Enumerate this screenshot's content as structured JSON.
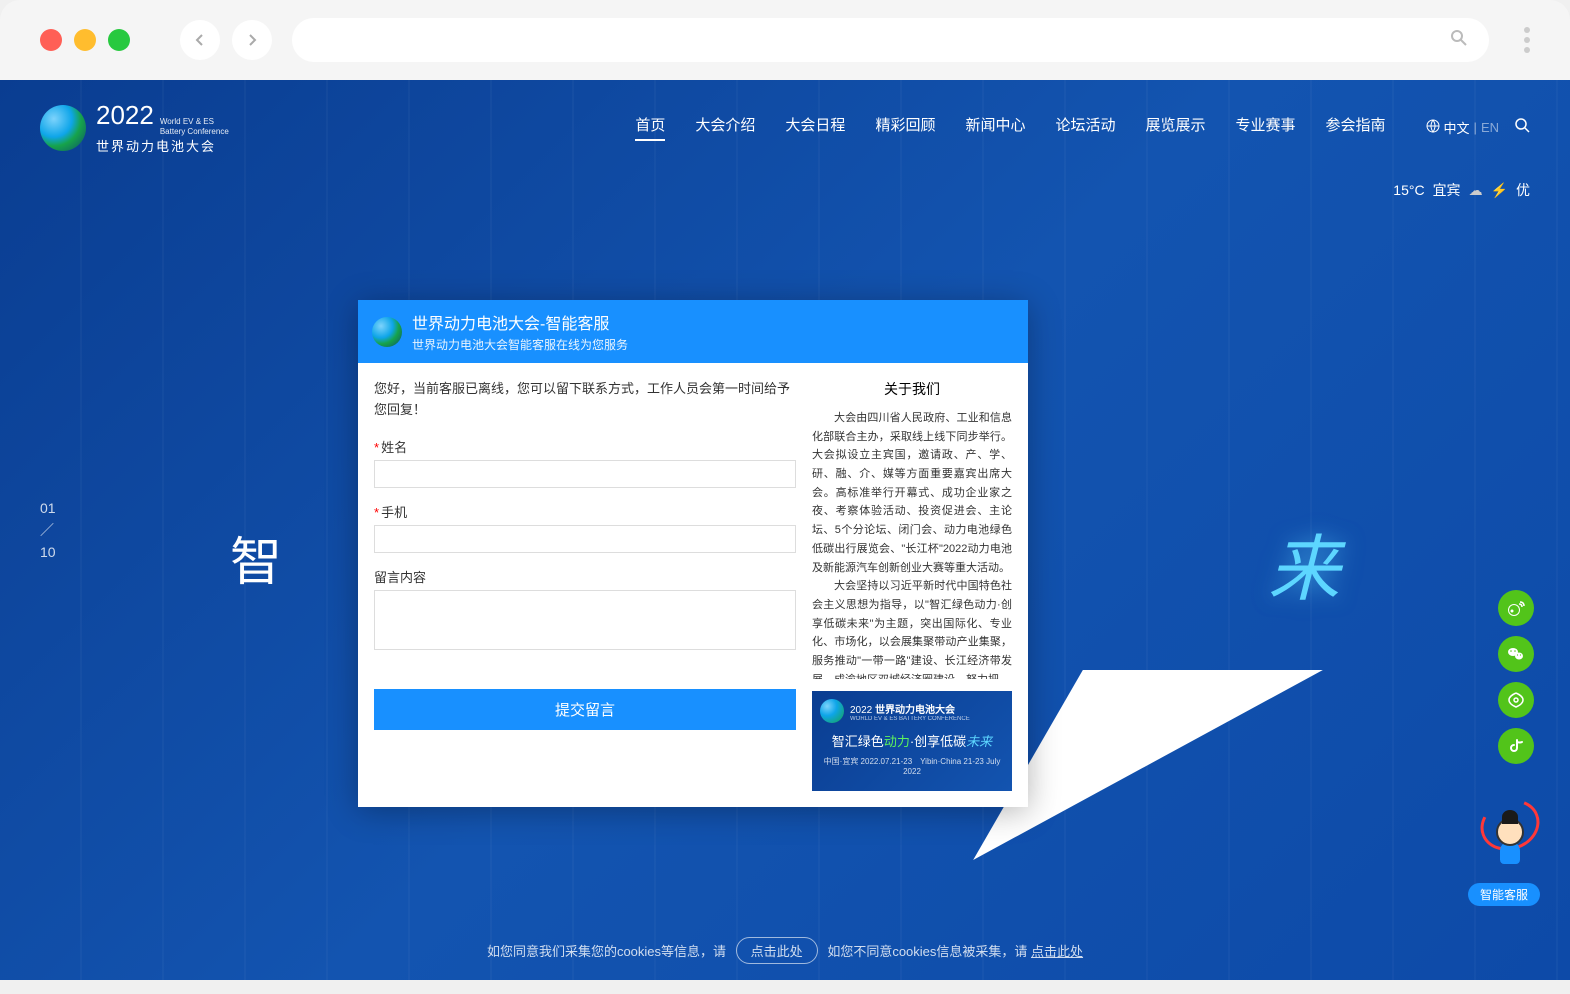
{
  "logo": {
    "year": "2022",
    "en_line1": "World EV & ES",
    "en_line2": "Battery Conference",
    "cn": "世界动力电池大会"
  },
  "nav": {
    "items": [
      "首页",
      "大会介绍",
      "大会日程",
      "精彩回顾",
      "新闻中心",
      "论坛活动",
      "展览展示",
      "专业赛事",
      "参会指南"
    ],
    "active_index": 0
  },
  "lang": {
    "active": "中文",
    "inactive": "EN"
  },
  "weather": {
    "temp": "15°C",
    "city": "宜宾",
    "quality": "优"
  },
  "slide": {
    "current": "01",
    "total": "10"
  },
  "hero": {
    "left": "智",
    "right": "来"
  },
  "modal": {
    "title": "世界动力电池大会-智能客服",
    "subtitle": "世界动力电池大会智能客服在线为您服务",
    "intro": "您好，当前客服已离线，您可以留下联系方式，工作人员会第一时间给予您回复！",
    "label_name": "姓名",
    "label_phone": "手机",
    "label_msg": "留言内容",
    "submit": "提交留言",
    "about_title": "关于我们",
    "about_p1": "大会由四川省人民政府、工业和信息化部联合主办，采取线上线下同步举行。大会拟设立主宾国，邀请政、产、学、研、融、介、媒等方面重要嘉宾出席大会。高标准举行开幕式、成功企业家之夜、考察体验活动、投资促进会、主论坛、5个分论坛、闭门会、动力电池绿色低碳出行展览会、\"长江杯\"2022动力电池及新能源汽车创新创业大赛等重大活动。",
    "about_p2": "大会坚持以习近平新时代中国特色社会主义思想为指导，以\"智汇绿色动力·创享低碳未来\"为主题，突出国际化、专业化、市场化，以会展集聚带动产业集聚，服务推动\"一带一路\"建设、长江经济带发展、成渝地区双城经济圈建设，努力把",
    "promo_year": "2022",
    "promo_title": "世界动力电池大会",
    "promo_sub": "WORLD EV & ES BATTERY CONFERENCE",
    "promo_slogan_a": "智汇绿色",
    "promo_slogan_b": "动力",
    "promo_slogan_c": "·创享低碳",
    "promo_slogan_d": "未来",
    "promo_date": "中国·宜宾 2022.07.21-23　Yibin·China  21-23 July 2022"
  },
  "chat_label": "智能客服",
  "cookie": {
    "text1": "如您同意我们采集您的cookies等信息，请",
    "btn": "点击此处",
    "text2": "如您不同意cookies信息被采集，请",
    "link": "点击此处"
  }
}
